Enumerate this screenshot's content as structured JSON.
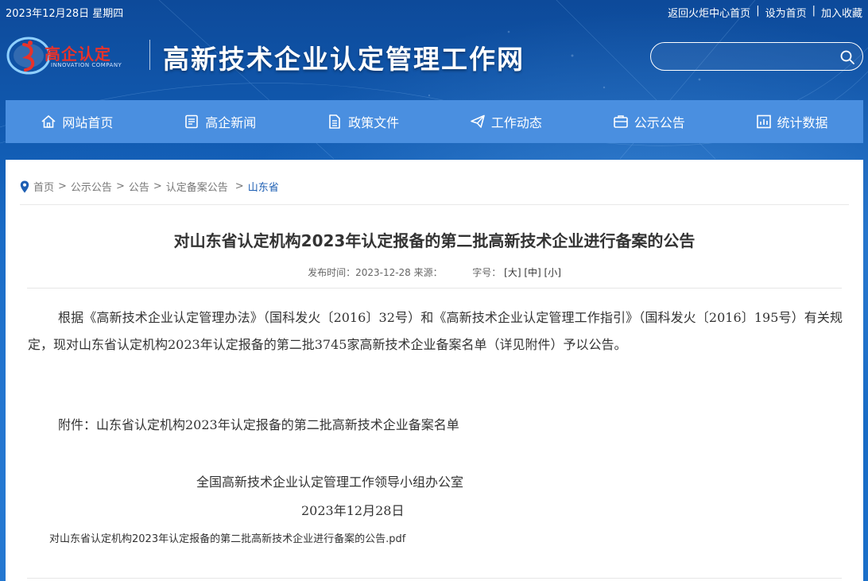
{
  "topbar": {
    "date": "2023年12月28日 星期四",
    "links": [
      "返回火炬中心首页",
      "设为首页",
      "加入收藏"
    ],
    "separator": "|"
  },
  "header": {
    "logo_text": "高企认定",
    "logo_sub": "INNOVATION COMPANY",
    "site_title": "高新技术企业认定管理工作网",
    "search": {
      "placeholder": "",
      "value": ""
    }
  },
  "nav": [
    {
      "label": "网站首页",
      "icon": "home-icon"
    },
    {
      "label": "高企新闻",
      "icon": "news-icon"
    },
    {
      "label": "政策文件",
      "icon": "document-icon"
    },
    {
      "label": "工作动态",
      "icon": "paper-plane-icon"
    },
    {
      "label": "公示公告",
      "icon": "announcement-icon"
    },
    {
      "label": "统计数据",
      "icon": "chart-icon"
    }
  ],
  "breadcrumb": {
    "items": [
      "首页",
      "公示公告",
      "公告",
      "认定备案公告"
    ],
    "current": "山东省",
    "separator": ">"
  },
  "article": {
    "title": "对山东省认定机构2023年认定报备的第二批高新技术企业进行备案的公告",
    "meta_publish": "发布时间：2023-12-28 来源：",
    "meta_fontsize_label": "字号：",
    "font_sizes": [
      "[大]",
      "[中]",
      "[小]"
    ],
    "body": "根据《高新技术企业认定管理办法》（国科发火〔2016〕32号）和《高新技术企业认定管理工作指引》（国科发火〔2016〕195号）有关规定，现对山东省认定机构2023年认定报备的第二批3745家高新技术企业备案名单（详见附件）予以公告。",
    "attachment": "附件：山东省认定机构2023年认定报备的第二批高新技术企业备案名单",
    "signature": "全国高新技术企业认定管理工作领导小组办公室",
    "sign_date": "2023年12月28日",
    "pdf_link": "对山东省认定机构2023年认定报备的第二批高新技术企业进行备案的公告.pdf"
  },
  "colors": {
    "nav_bg": "#4a8fe0",
    "header_bg": "#1567c2",
    "logo_red": "#e8322a",
    "breadcrumb_current": "#1e5fb3"
  }
}
